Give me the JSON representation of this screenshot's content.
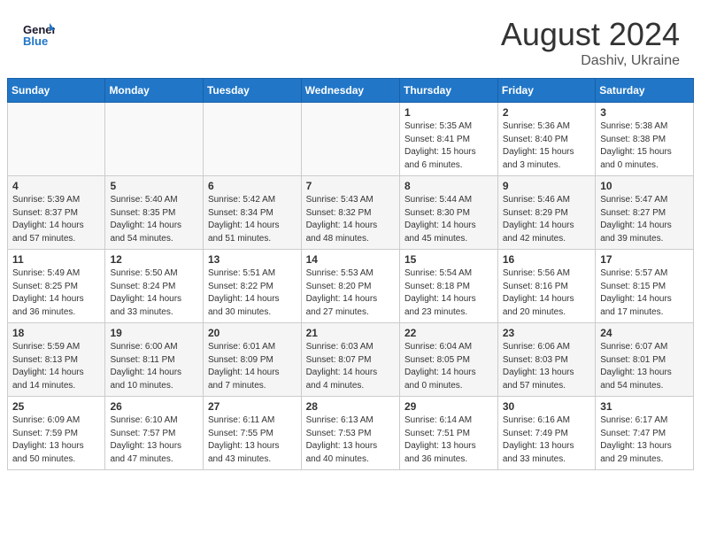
{
  "header": {
    "logo_line1": "General",
    "logo_line2": "Blue",
    "month_year": "August 2024",
    "location": "Dashiv, Ukraine"
  },
  "weekdays": [
    "Sunday",
    "Monday",
    "Tuesday",
    "Wednesday",
    "Thursday",
    "Friday",
    "Saturday"
  ],
  "weeks": [
    [
      {
        "day": "",
        "info": ""
      },
      {
        "day": "",
        "info": ""
      },
      {
        "day": "",
        "info": ""
      },
      {
        "day": "",
        "info": ""
      },
      {
        "day": "1",
        "info": "Sunrise: 5:35 AM\nSunset: 8:41 PM\nDaylight: 15 hours\nand 6 minutes."
      },
      {
        "day": "2",
        "info": "Sunrise: 5:36 AM\nSunset: 8:40 PM\nDaylight: 15 hours\nand 3 minutes."
      },
      {
        "day": "3",
        "info": "Sunrise: 5:38 AM\nSunset: 8:38 PM\nDaylight: 15 hours\nand 0 minutes."
      }
    ],
    [
      {
        "day": "4",
        "info": "Sunrise: 5:39 AM\nSunset: 8:37 PM\nDaylight: 14 hours\nand 57 minutes."
      },
      {
        "day": "5",
        "info": "Sunrise: 5:40 AM\nSunset: 8:35 PM\nDaylight: 14 hours\nand 54 minutes."
      },
      {
        "day": "6",
        "info": "Sunrise: 5:42 AM\nSunset: 8:34 PM\nDaylight: 14 hours\nand 51 minutes."
      },
      {
        "day": "7",
        "info": "Sunrise: 5:43 AM\nSunset: 8:32 PM\nDaylight: 14 hours\nand 48 minutes."
      },
      {
        "day": "8",
        "info": "Sunrise: 5:44 AM\nSunset: 8:30 PM\nDaylight: 14 hours\nand 45 minutes."
      },
      {
        "day": "9",
        "info": "Sunrise: 5:46 AM\nSunset: 8:29 PM\nDaylight: 14 hours\nand 42 minutes."
      },
      {
        "day": "10",
        "info": "Sunrise: 5:47 AM\nSunset: 8:27 PM\nDaylight: 14 hours\nand 39 minutes."
      }
    ],
    [
      {
        "day": "11",
        "info": "Sunrise: 5:49 AM\nSunset: 8:25 PM\nDaylight: 14 hours\nand 36 minutes."
      },
      {
        "day": "12",
        "info": "Sunrise: 5:50 AM\nSunset: 8:24 PM\nDaylight: 14 hours\nand 33 minutes."
      },
      {
        "day": "13",
        "info": "Sunrise: 5:51 AM\nSunset: 8:22 PM\nDaylight: 14 hours\nand 30 minutes."
      },
      {
        "day": "14",
        "info": "Sunrise: 5:53 AM\nSunset: 8:20 PM\nDaylight: 14 hours\nand 27 minutes."
      },
      {
        "day": "15",
        "info": "Sunrise: 5:54 AM\nSunset: 8:18 PM\nDaylight: 14 hours\nand 23 minutes."
      },
      {
        "day": "16",
        "info": "Sunrise: 5:56 AM\nSunset: 8:16 PM\nDaylight: 14 hours\nand 20 minutes."
      },
      {
        "day": "17",
        "info": "Sunrise: 5:57 AM\nSunset: 8:15 PM\nDaylight: 14 hours\nand 17 minutes."
      }
    ],
    [
      {
        "day": "18",
        "info": "Sunrise: 5:59 AM\nSunset: 8:13 PM\nDaylight: 14 hours\nand 14 minutes."
      },
      {
        "day": "19",
        "info": "Sunrise: 6:00 AM\nSunset: 8:11 PM\nDaylight: 14 hours\nand 10 minutes."
      },
      {
        "day": "20",
        "info": "Sunrise: 6:01 AM\nSunset: 8:09 PM\nDaylight: 14 hours\nand 7 minutes."
      },
      {
        "day": "21",
        "info": "Sunrise: 6:03 AM\nSunset: 8:07 PM\nDaylight: 14 hours\nand 4 minutes."
      },
      {
        "day": "22",
        "info": "Sunrise: 6:04 AM\nSunset: 8:05 PM\nDaylight: 14 hours\nand 0 minutes."
      },
      {
        "day": "23",
        "info": "Sunrise: 6:06 AM\nSunset: 8:03 PM\nDaylight: 13 hours\nand 57 minutes."
      },
      {
        "day": "24",
        "info": "Sunrise: 6:07 AM\nSunset: 8:01 PM\nDaylight: 13 hours\nand 54 minutes."
      }
    ],
    [
      {
        "day": "25",
        "info": "Sunrise: 6:09 AM\nSunset: 7:59 PM\nDaylight: 13 hours\nand 50 minutes."
      },
      {
        "day": "26",
        "info": "Sunrise: 6:10 AM\nSunset: 7:57 PM\nDaylight: 13 hours\nand 47 minutes."
      },
      {
        "day": "27",
        "info": "Sunrise: 6:11 AM\nSunset: 7:55 PM\nDaylight: 13 hours\nand 43 minutes."
      },
      {
        "day": "28",
        "info": "Sunrise: 6:13 AM\nSunset: 7:53 PM\nDaylight: 13 hours\nand 40 minutes."
      },
      {
        "day": "29",
        "info": "Sunrise: 6:14 AM\nSunset: 7:51 PM\nDaylight: 13 hours\nand 36 minutes."
      },
      {
        "day": "30",
        "info": "Sunrise: 6:16 AM\nSunset: 7:49 PM\nDaylight: 13 hours\nand 33 minutes."
      },
      {
        "day": "31",
        "info": "Sunrise: 6:17 AM\nSunset: 7:47 PM\nDaylight: 13 hours\nand 29 minutes."
      }
    ]
  ]
}
